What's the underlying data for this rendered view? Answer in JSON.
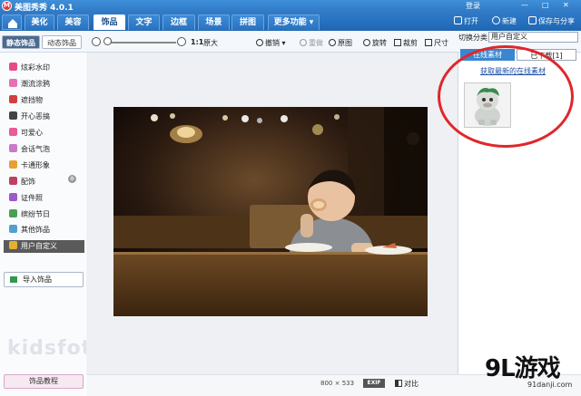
{
  "window": {
    "title": "美图秀秀 4.0.1",
    "login": "登录",
    "minimize_glyph": "—",
    "maximize_glyph": "□",
    "close_glyph": "✕"
  },
  "tabs": [
    {
      "label": "美化"
    },
    {
      "label": "美容"
    },
    {
      "label": "饰品"
    },
    {
      "label": "文字"
    },
    {
      "label": "边框"
    },
    {
      "label": "场景"
    },
    {
      "label": "拼图"
    },
    {
      "label": "更多功能 ▾"
    }
  ],
  "header_actions": {
    "open": "打开",
    "new": "新建",
    "save_share": "保存与分享"
  },
  "toolbar": {
    "side_tab_static": "静态饰品",
    "side_tab_dynamic": "动态饰品",
    "zoom_preset": "1:1",
    "zoom_original": "原大",
    "undo": "撤销 ▾",
    "redo": "重做",
    "restore_original": "原图",
    "rotate": "旋转",
    "crop": "裁剪",
    "resize": "尺寸",
    "zoom_progress": 0.0
  },
  "left_panel": {
    "items": [
      {
        "label": "炫彩水印",
        "color": "#e84b8a"
      },
      {
        "label": "潮流涂鸦",
        "color": "#e86fb0"
      },
      {
        "label": "遮挡物",
        "color": "#d04040"
      },
      {
        "label": "开心恶搞",
        "color": "#444444"
      },
      {
        "label": "可爱心",
        "color": "#e85a9a"
      },
      {
        "label": "会话气泡",
        "color": "#c879c8"
      },
      {
        "label": "卡通形象",
        "color": "#e8a030"
      },
      {
        "label": "配饰",
        "color": "#c04060"
      },
      {
        "label": "证件照",
        "color": "#9a5ac8"
      },
      {
        "label": "缤纷节日",
        "color": "#4aa050"
      },
      {
        "label": "其他饰品",
        "color": "#50a0d0"
      },
      {
        "label": "用户自定义",
        "color": "#e8b030"
      }
    ],
    "import_button": "导入饰品",
    "tutorial_button": "饰品教程",
    "watermark": "kidsfoto"
  },
  "status": {
    "width": "800",
    "times": "×",
    "height": "533",
    "exif": "EXIF",
    "compare": "对比"
  },
  "right_panel": {
    "category_label": "切换分类:",
    "category_value": "用户自定义",
    "tab_online": "在线素材",
    "tab_downloaded": "已下载[1]",
    "get_latest_link": "获取最新的在线素材"
  },
  "watermark": {
    "logo": "9L游戏",
    "url": "91danji.com"
  },
  "colors": {
    "accent_blue": "#2f78c4",
    "highlight_circle": "#e0262b",
    "link": "#1d4fa8"
  }
}
